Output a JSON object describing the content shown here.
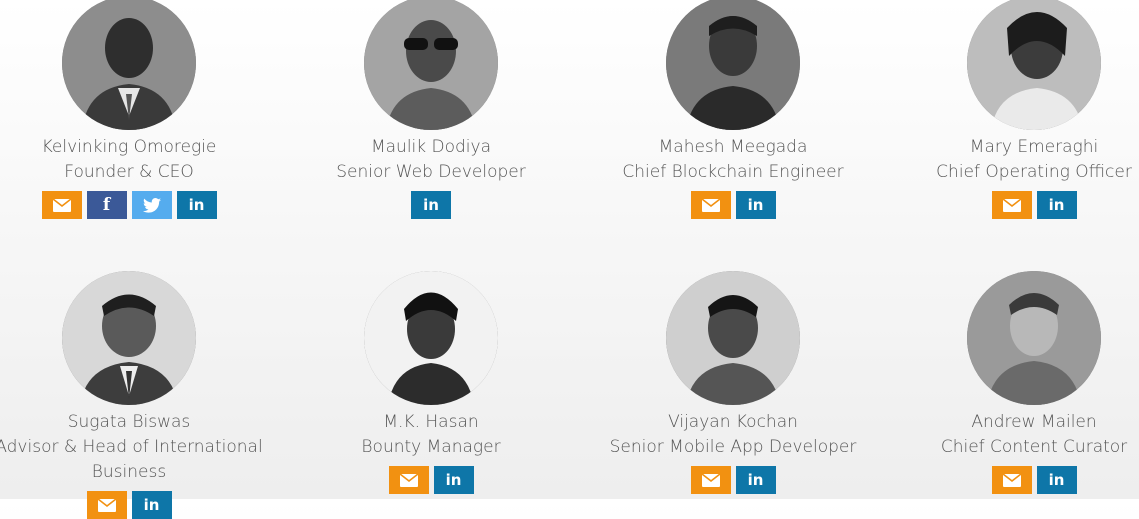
{
  "colors": {
    "email": "#f29111",
    "facebook": "#3b5998",
    "twitter": "#55acee",
    "linkedin": "#0e76a8",
    "text": "#555555"
  },
  "team": [
    {
      "name": "Kelvinking Omoregie",
      "role": "Founder & CEO",
      "photo": "photo-of-kelvinking-omoregie",
      "socials": [
        "email-icon",
        "facebook-icon",
        "twitter-icon",
        "linkedin-icon"
      ]
    },
    {
      "name": "Maulik Dodiya",
      "role": "Senior Web Developer",
      "photo": "photo-of-maulik-dodiya",
      "socials": [
        "linkedin-icon"
      ]
    },
    {
      "name": "Mahesh Meegada",
      "role": "Chief Blockchain Engineer",
      "photo": "photo-of-mahesh-meegada",
      "socials": [
        "email-icon",
        "linkedin-icon"
      ]
    },
    {
      "name": "Mary Emeraghi",
      "role": "Chief Operating Officer",
      "photo": "photo-of-mary-emeraghi",
      "socials": [
        "email-icon",
        "linkedin-icon"
      ]
    },
    {
      "name": "Sugata Biswas",
      "role": "Advisor & Head of International",
      "role_line2": "Business",
      "photo": "photo-of-sugata-biswas",
      "socials": [
        "email-icon",
        "linkedin-icon"
      ]
    },
    {
      "name": "M.K. Hasan",
      "role": "Bounty Manager",
      "photo": "photo-of-mk-hasan",
      "socials": [
        "email-icon",
        "linkedin-icon"
      ]
    },
    {
      "name": "Vijayan Kochan",
      "role": "Senior Mobile App Developer",
      "photo": "photo-of-vijayan-kochan",
      "socials": [
        "email-icon",
        "linkedin-icon"
      ]
    },
    {
      "name": "Andrew Mailen",
      "role": "Chief Content Curator",
      "photo": "photo-of-andrew-mailen",
      "socials": [
        "email-icon",
        "linkedin-icon"
      ]
    }
  ]
}
